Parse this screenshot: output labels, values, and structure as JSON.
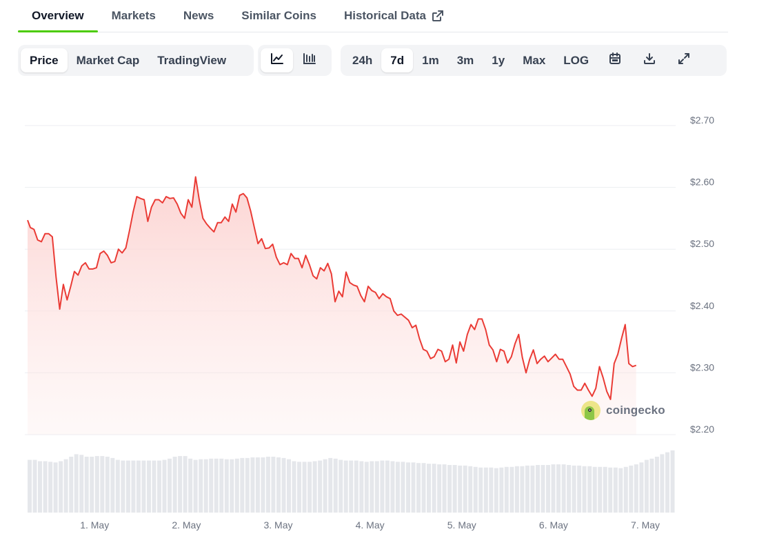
{
  "nav": {
    "tabs": [
      {
        "label": "Overview",
        "active": true
      },
      {
        "label": "Markets"
      },
      {
        "label": "News"
      },
      {
        "label": "Similar Coins"
      },
      {
        "label": "Historical Data",
        "icon": "external-link-icon"
      }
    ]
  },
  "toolbar": {
    "chart_types": [
      {
        "label": "Price",
        "active": true
      },
      {
        "label": "Market Cap"
      },
      {
        "label": "TradingView"
      }
    ],
    "view_icons": [
      "line-chart-icon",
      "candlestick-chart-icon"
    ],
    "ranges": [
      {
        "label": "24h"
      },
      {
        "label": "7d",
        "active": true
      },
      {
        "label": "1m"
      },
      {
        "label": "3m"
      },
      {
        "label": "1y"
      },
      {
        "label": "Max"
      },
      {
        "label": "LOG"
      }
    ],
    "tool_icons": [
      "calendar-icon",
      "download-icon",
      "expand-icon"
    ]
  },
  "watermark": {
    "text": "coingecko"
  },
  "colors": {
    "line": "#ea3b35",
    "fill_top": "#fcd2d0",
    "volume": "#e5e7eb",
    "grid": "#eceef1",
    "accent": "#4bcc00"
  },
  "chart_data": {
    "type": "area",
    "title": "",
    "xlabel": "",
    "ylabel": "",
    "ylim": [
      2.2,
      2.7
    ],
    "y_ticks": [
      "$2.70",
      "$2.60",
      "$2.50",
      "$2.40",
      "$2.30",
      "$2.20"
    ],
    "y_tick_values": [
      2.7,
      2.6,
      2.5,
      2.4,
      2.3,
      2.2
    ],
    "x_ticks": [
      "1. May",
      "2. May",
      "3. May",
      "4. May",
      "5. May",
      "6. May",
      "7. May"
    ],
    "x_tick_positions": [
      1,
      2,
      3,
      4,
      5,
      6,
      7
    ],
    "x_range": [
      0.27,
      7.33
    ],
    "series": [
      {
        "points": [
          [
            0.27,
            2.547
          ],
          [
            0.3,
            2.535
          ],
          [
            0.34,
            2.532
          ],
          [
            0.38,
            2.515
          ],
          [
            0.42,
            2.512
          ],
          [
            0.46,
            2.525
          ],
          [
            0.5,
            2.525
          ],
          [
            0.54,
            2.52
          ],
          [
            0.58,
            2.455
          ],
          [
            0.62,
            2.403
          ],
          [
            0.66,
            2.443
          ],
          [
            0.7,
            2.418
          ],
          [
            0.74,
            2.44
          ],
          [
            0.78,
            2.464
          ],
          [
            0.82,
            2.458
          ],
          [
            0.86,
            2.473
          ],
          [
            0.9,
            2.478
          ],
          [
            0.94,
            2.468
          ],
          [
            0.98,
            2.468
          ],
          [
            1.02,
            2.47
          ],
          [
            1.06,
            2.493
          ],
          [
            1.1,
            2.497
          ],
          [
            1.14,
            2.49
          ],
          [
            1.18,
            2.478
          ],
          [
            1.22,
            2.48
          ],
          [
            1.26,
            2.5
          ],
          [
            1.3,
            2.494
          ],
          [
            1.34,
            2.502
          ],
          [
            1.38,
            2.53
          ],
          [
            1.42,
            2.56
          ],
          [
            1.46,
            2.585
          ],
          [
            1.5,
            2.582
          ],
          [
            1.54,
            2.58
          ],
          [
            1.58,
            2.545
          ],
          [
            1.62,
            2.568
          ],
          [
            1.66,
            2.58
          ],
          [
            1.7,
            2.58
          ],
          [
            1.74,
            2.575
          ],
          [
            1.78,
            2.585
          ],
          [
            1.82,
            2.582
          ],
          [
            1.86,
            2.583
          ],
          [
            1.9,
            2.573
          ],
          [
            1.94,
            2.558
          ],
          [
            1.98,
            2.55
          ],
          [
            2.02,
            2.58
          ],
          [
            2.06,
            2.568
          ],
          [
            2.1,
            2.617
          ],
          [
            2.14,
            2.58
          ],
          [
            2.18,
            2.55
          ],
          [
            2.22,
            2.541
          ],
          [
            2.26,
            2.534
          ],
          [
            2.3,
            2.528
          ],
          [
            2.34,
            2.543
          ],
          [
            2.38,
            2.543
          ],
          [
            2.42,
            2.552
          ],
          [
            2.46,
            2.545
          ],
          [
            2.5,
            2.573
          ],
          [
            2.54,
            2.56
          ],
          [
            2.58,
            2.587
          ],
          [
            2.62,
            2.59
          ],
          [
            2.66,
            2.583
          ],
          [
            2.7,
            2.562
          ],
          [
            2.74,
            2.535
          ],
          [
            2.78,
            2.509
          ],
          [
            2.82,
            2.517
          ],
          [
            2.86,
            2.501
          ],
          [
            2.9,
            2.502
          ],
          [
            2.94,
            2.508
          ],
          [
            2.98,
            2.487
          ],
          [
            3.02,
            2.475
          ],
          [
            3.06,
            2.478
          ],
          [
            3.1,
            2.475
          ],
          [
            3.14,
            2.493
          ],
          [
            3.18,
            2.485
          ],
          [
            3.22,
            2.485
          ],
          [
            3.26,
            2.47
          ],
          [
            3.3,
            2.49
          ],
          [
            3.34,
            2.475
          ],
          [
            3.38,
            2.457
          ],
          [
            3.42,
            2.452
          ],
          [
            3.46,
            2.47
          ],
          [
            3.5,
            2.465
          ],
          [
            3.54,
            2.477
          ],
          [
            3.58,
            2.46
          ],
          [
            3.62,
            2.415
          ],
          [
            3.66,
            2.432
          ],
          [
            3.7,
            2.423
          ],
          [
            3.74,
            2.463
          ],
          [
            3.78,
            2.446
          ],
          [
            3.82,
            2.442
          ],
          [
            3.86,
            2.44
          ],
          [
            3.9,
            2.425
          ],
          [
            3.94,
            2.415
          ],
          [
            3.98,
            2.44
          ],
          [
            4.02,
            2.433
          ],
          [
            4.06,
            2.43
          ],
          [
            4.1,
            2.42
          ],
          [
            4.14,
            2.428
          ],
          [
            4.18,
            2.423
          ],
          [
            4.22,
            2.42
          ],
          [
            4.26,
            2.4
          ],
          [
            4.3,
            2.393
          ],
          [
            4.34,
            2.395
          ],
          [
            4.38,
            2.39
          ],
          [
            4.42,
            2.385
          ],
          [
            4.46,
            2.373
          ],
          [
            4.5,
            2.377
          ],
          [
            4.54,
            2.355
          ],
          [
            4.58,
            2.338
          ],
          [
            4.62,
            2.335
          ],
          [
            4.66,
            2.323
          ],
          [
            4.7,
            2.326
          ],
          [
            4.74,
            2.338
          ],
          [
            4.78,
            2.335
          ],
          [
            4.82,
            2.318
          ],
          [
            4.86,
            2.322
          ],
          [
            4.9,
            2.345
          ],
          [
            4.94,
            2.316
          ],
          [
            4.98,
            2.35
          ],
          [
            5.02,
            2.335
          ],
          [
            5.06,
            2.362
          ],
          [
            5.1,
            2.378
          ],
          [
            5.14,
            2.37
          ],
          [
            5.18,
            2.387
          ],
          [
            5.22,
            2.387
          ],
          [
            5.26,
            2.37
          ],
          [
            5.3,
            2.345
          ],
          [
            5.34,
            2.337
          ],
          [
            5.38,
            2.318
          ],
          [
            5.42,
            2.338
          ],
          [
            5.46,
            2.335
          ],
          [
            5.5,
            2.316
          ],
          [
            5.54,
            2.326
          ],
          [
            5.58,
            2.347
          ],
          [
            5.62,
            2.362
          ],
          [
            5.66,
            2.325
          ],
          [
            5.7,
            2.3
          ],
          [
            5.74,
            2.322
          ],
          [
            5.78,
            2.337
          ],
          [
            5.82,
            2.315
          ],
          [
            5.86,
            2.322
          ],
          [
            5.9,
            2.327
          ],
          [
            5.94,
            2.318
          ],
          [
            5.98,
            2.324
          ],
          [
            6.02,
            2.33
          ],
          [
            6.06,
            2.322
          ],
          [
            6.1,
            2.322
          ],
          [
            6.14,
            2.31
          ],
          [
            6.18,
            2.298
          ],
          [
            6.22,
            2.278
          ],
          [
            6.26,
            2.272
          ],
          [
            6.3,
            2.272
          ],
          [
            6.34,
            2.283
          ],
          [
            6.38,
            2.272
          ],
          [
            6.42,
            2.262
          ],
          [
            6.46,
            2.275
          ],
          [
            6.5,
            2.31
          ],
          [
            6.54,
            2.292
          ],
          [
            6.58,
            2.27
          ],
          [
            6.62,
            2.257
          ],
          [
            6.66,
            2.315
          ],
          [
            6.7,
            2.33
          ],
          [
            6.74,
            2.355
          ],
          [
            6.78,
            2.378
          ],
          [
            6.82,
            2.315
          ],
          [
            6.86,
            2.31
          ],
          [
            6.9,
            2.312
          ]
        ]
      }
    ],
    "volume_relative": [
      0.83,
      0.83,
      0.81,
      0.81,
      0.8,
      0.79,
      0.81,
      0.84,
      0.88,
      0.92,
      0.91,
      0.88,
      0.88,
      0.89,
      0.89,
      0.88,
      0.86,
      0.83,
      0.82,
      0.82,
      0.82,
      0.82,
      0.82,
      0.82,
      0.82,
      0.82,
      0.83,
      0.85,
      0.88,
      0.89,
      0.89,
      0.85,
      0.83,
      0.84,
      0.84,
      0.85,
      0.85,
      0.85,
      0.84,
      0.84,
      0.85,
      0.86,
      0.86,
      0.87,
      0.87,
      0.87,
      0.88,
      0.88,
      0.87,
      0.86,
      0.84,
      0.81,
      0.8,
      0.8,
      0.8,
      0.81,
      0.82,
      0.84,
      0.86,
      0.85,
      0.83,
      0.82,
      0.82,
      0.82,
      0.81,
      0.8,
      0.81,
      0.81,
      0.82,
      0.82,
      0.81,
      0.8,
      0.8,
      0.79,
      0.79,
      0.78,
      0.78,
      0.77,
      0.77,
      0.76,
      0.76,
      0.75,
      0.75,
      0.74,
      0.74,
      0.73,
      0.72,
      0.71,
      0.71,
      0.71,
      0.7,
      0.71,
      0.72,
      0.72,
      0.73,
      0.73,
      0.74,
      0.74,
      0.75,
      0.75,
      0.75,
      0.76,
      0.76,
      0.76,
      0.75,
      0.74,
      0.74,
      0.73,
      0.73,
      0.72,
      0.72,
      0.72,
      0.71,
      0.71,
      0.7,
      0.72,
      0.74,
      0.76,
      0.79,
      0.83,
      0.85,
      0.88,
      0.92,
      0.95,
      0.98
    ]
  }
}
